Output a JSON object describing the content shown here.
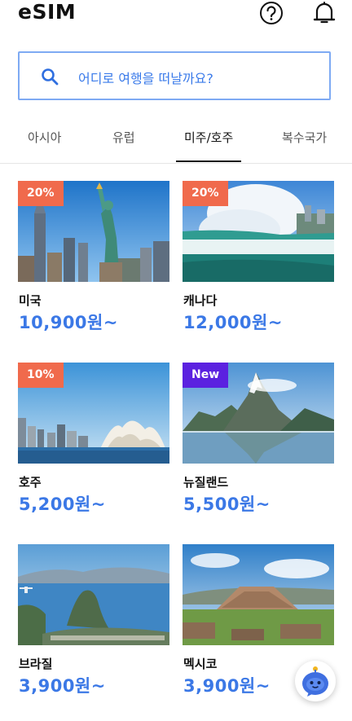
{
  "header": {
    "title": "eSIM",
    "help_icon": "help-circle-icon",
    "notification_icon": "bell-icon"
  },
  "search": {
    "placeholder": "어디로 여행을 떠날까요?",
    "icon": "search-icon"
  },
  "tabs": [
    {
      "label": "아시아",
      "active": false
    },
    {
      "label": "유럽",
      "active": false
    },
    {
      "label": "미주/호주",
      "active": true
    },
    {
      "label": "복수국가",
      "active": false
    }
  ],
  "destinations": [
    {
      "name": "미국",
      "price": "10,900원~",
      "badge": "20%",
      "badge_type": "discount"
    },
    {
      "name": "캐나다",
      "price": "12,000원~",
      "badge": "20%",
      "badge_type": "discount"
    },
    {
      "name": "호주",
      "price": "5,200원~",
      "badge": "10%",
      "badge_type": "discount"
    },
    {
      "name": "뉴질랜드",
      "price": "5,500원~",
      "badge": "New",
      "badge_type": "new"
    },
    {
      "name": "브라질",
      "price": "3,900원~",
      "badge": "",
      "badge_type": "none"
    },
    {
      "name": "멕시코",
      "price": "3,900원~",
      "badge": "",
      "badge_type": "none"
    }
  ],
  "colors": {
    "accent": "#3b78e6",
    "discount_badge": "#f06a4c",
    "new_badge": "#5b21e0",
    "search_border": "#7eaaf3"
  },
  "chat_button": {
    "icon": "chatbot-icon"
  }
}
